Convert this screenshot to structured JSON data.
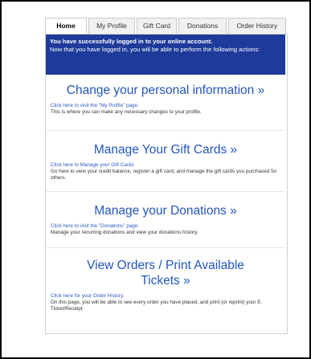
{
  "tabs": [
    {
      "label": "Home",
      "active": true
    },
    {
      "label": "My Profile",
      "active": false
    },
    {
      "label": "Gift Card",
      "active": false
    },
    {
      "label": "Donations",
      "active": false
    },
    {
      "label": "Order History",
      "active": false
    }
  ],
  "banner": {
    "line1": "You have successfully logged in to your online account.",
    "line2": "Now that you have logged in, you will be able to perform the following actions:"
  },
  "cards": [
    {
      "title": "Change your personal information »",
      "link": "Click here to visit the \"My Profile\" page.",
      "desc": "This is where you can make any necessary changes to your profile."
    },
    {
      "title": "Manage Your Gift Cards »",
      "link": "Click here to Manage your Gift Cards",
      "desc": "Go here to view your credit balance, register a gift card, and manage the gift cards you purchased for others."
    },
    {
      "title": "Manage your Donations »",
      "link": "Click here to visit the \"Donations\" page.",
      "desc": "Manage your recurring donations and view your donations history."
    },
    {
      "title": "View Orders / Print Available Tickets »",
      "link": "Click here for your Order History.",
      "desc": "On this page, you will be able to see every order you have placed, and print (or reprint) your E-Ticket/Receipt."
    }
  ],
  "colors": {
    "banner": "#1e3a9a",
    "link": "#2456bd"
  }
}
